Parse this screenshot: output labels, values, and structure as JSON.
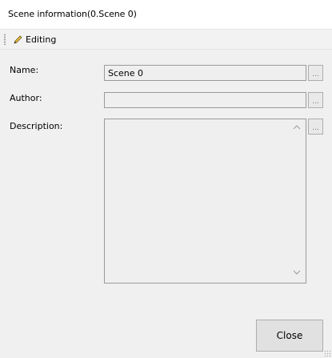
{
  "window": {
    "title": "Scene information(0.Scene 0)"
  },
  "toolbar": {
    "editing_label": "Editing"
  },
  "form": {
    "name_label": "Name:",
    "name_value": "Scene 0",
    "author_label": "Author:",
    "author_value": "",
    "description_label": "Description:",
    "description_value": "",
    "browse_label": "..."
  },
  "footer": {
    "close_label": "Close"
  },
  "icons": {
    "pencil": "pencil-icon",
    "scroll_up": "chevron-up-icon",
    "scroll_down": "chevron-down-icon"
  }
}
